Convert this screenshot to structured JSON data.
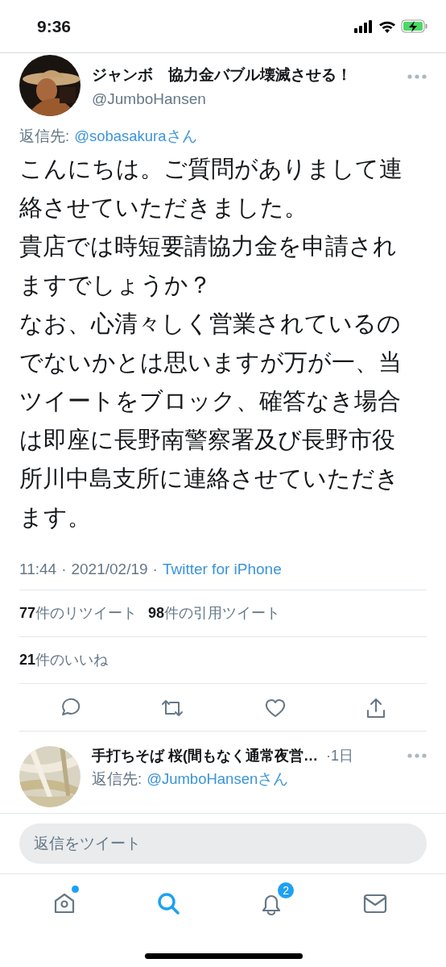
{
  "status_bar": {
    "time": "9:36"
  },
  "tweet": {
    "display_name": "ジャンボ　協力金バブル壊滅させる！",
    "handle": "@JumboHansen",
    "reply_label": "返信先:",
    "reply_to": "@sobasakuraさん",
    "paragraphs": [
      "こんにちは。ご質問がありまして連絡させていただきました。",
      "貴店では時短要請協力金を申請されますでしょうか？",
      "なお、心清々しく営業されているのでないかとは思いますが万が一、当ツイートをブロック、確答なき場合は即座に長野南警察署及び長野市役所川中島支所に連絡させていただきます。"
    ],
    "time": "11:44",
    "separator_1": "·",
    "date": "2021/02/19",
    "separator_2": "·",
    "source": "Twitter for iPhone",
    "stats": [
      {
        "count": "77",
        "label": "件のリツイート"
      },
      {
        "count": "98",
        "label": "件の引用ツイート"
      }
    ],
    "likes": {
      "count": "21",
      "label": "件のいいね"
    }
  },
  "replies": [
    {
      "display_name": "手打ちそば 桜(間もなく通常夜営…",
      "age": "·1日",
      "reply_label": "返信先:",
      "reply_to": "@JumboHansenさん"
    }
  ],
  "reply_bar": {
    "placeholder": "返信をツイート"
  },
  "tab_bar": {
    "tabs": [
      {
        "kind": "home",
        "selected": false,
        "dot": true
      },
      {
        "kind": "search",
        "selected": true
      },
      {
        "kind": "notifications",
        "selected": false,
        "badge": "2"
      },
      {
        "kind": "messages",
        "selected": false
      }
    ]
  }
}
